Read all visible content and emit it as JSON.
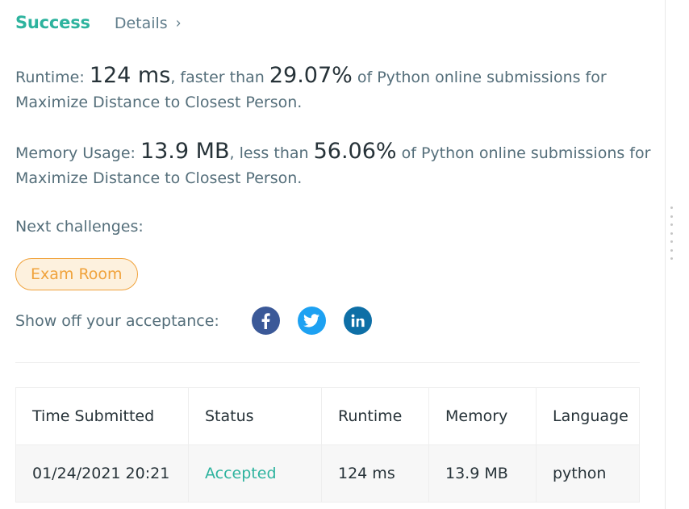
{
  "header": {
    "status": "Success",
    "details_label": "Details",
    "details_chevron": "›"
  },
  "runtime": {
    "label": "Runtime: ",
    "value": "124 ms",
    "mid": ", faster than ",
    "percent": "29.07%",
    "suffix": " of Python online submissions for Maximize Distance to Closest Person."
  },
  "memory": {
    "label": "Memory Usage: ",
    "value": "13.9 MB",
    "mid": ", less than ",
    "percent": "56.06%",
    "suffix": " of Python online submissions for Maximize Distance to Closest Person."
  },
  "next_challenges": {
    "label": "Next challenges:",
    "items": [
      "Exam Room"
    ]
  },
  "share": {
    "label": "Show off your acceptance:",
    "icons": [
      {
        "name": "facebook-icon",
        "glyph": "f"
      },
      {
        "name": "twitter-icon",
        "glyph": "🐦"
      },
      {
        "name": "linkedin-icon",
        "glyph": "in"
      }
    ]
  },
  "table": {
    "headers": [
      "Time Submitted",
      "Status",
      "Runtime",
      "Memory",
      "Language"
    ],
    "rows": [
      [
        "01/24/2021 20:21",
        "Accepted",
        "124 ms",
        "13.9 MB",
        "python"
      ]
    ]
  },
  "colors": {
    "success": "#2db39e",
    "chip_border": "#f0a23b",
    "chip_bg": "#fdf1de",
    "facebook": "#3b5998",
    "twitter": "#1da1f2",
    "linkedin": "#0e6fa6"
  }
}
